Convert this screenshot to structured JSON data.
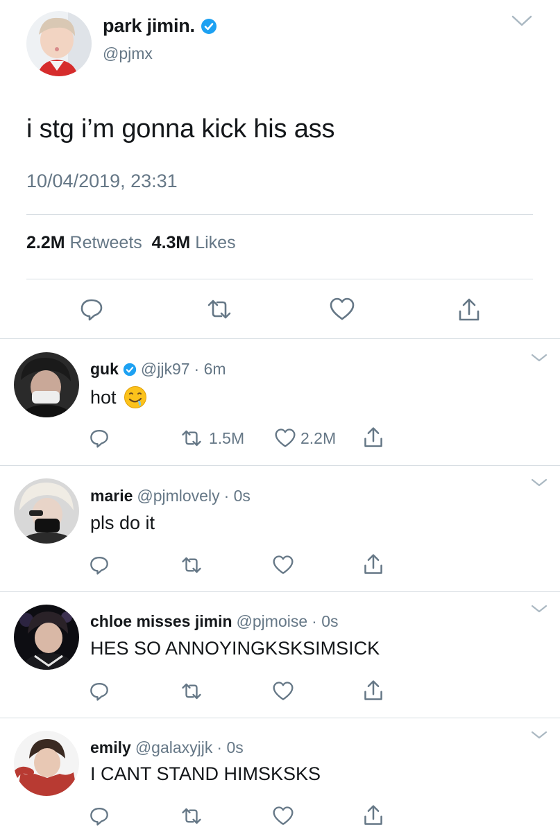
{
  "main": {
    "name": "park jimin.",
    "handle": "@pjmx",
    "text": "i stg i’m gonna kick his ass",
    "timestamp": "10/04/2019, 23:31",
    "retweets_count": "2.2M",
    "retweets_label": "Retweets",
    "likes_count": "4.3M",
    "likes_label": "Likes",
    "verified": true
  },
  "replies": [
    {
      "name": "guk",
      "verified": true,
      "handle": "@jjk97",
      "time": "· 6m",
      "text": "hot",
      "emoji": "drooling-face",
      "retweets": "1.5M",
      "likes": "2.2M"
    },
    {
      "name": "marie",
      "verified": false,
      "handle": "@pjmlovely",
      "time": "· 0s",
      "text": "pls do it",
      "retweets": "",
      "likes": ""
    },
    {
      "name": "chloe misses jimin",
      "verified": false,
      "handle": "@pjmoise",
      "time": "· 0s",
      "text": "HES SO ANNOYINGKSKSIMSICK",
      "retweets": "",
      "likes": ""
    },
    {
      "name": "emily",
      "verified": false,
      "handle": "@galaxyjjk",
      "time": "· 0s",
      "text": "I CANT STAND HIMSKSKS",
      "retweets": "",
      "likes": ""
    }
  ],
  "icons": {
    "reply": "reply-icon",
    "retweet": "retweet-icon",
    "like": "heart-icon",
    "share": "share-icon",
    "menu": "chevron-down-icon",
    "verified": "verified-badge-icon"
  },
  "colors": {
    "text": "#14171a",
    "secondary": "#657786",
    "verified": "#1da1f2",
    "divider": "#d7dde2"
  }
}
